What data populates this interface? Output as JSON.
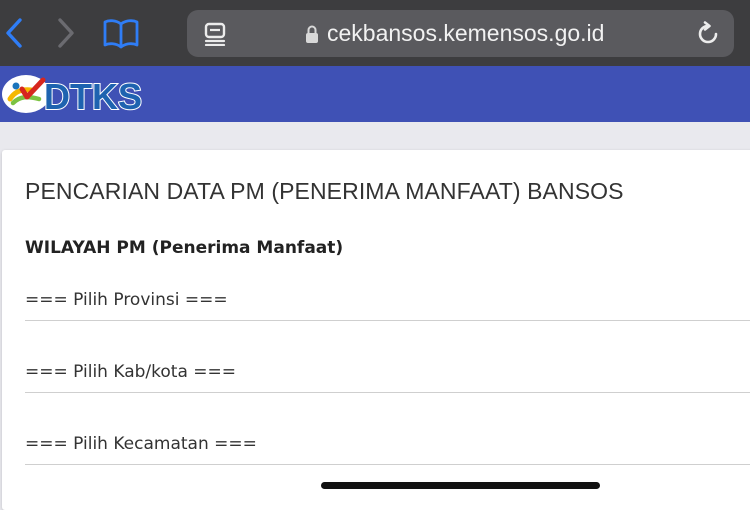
{
  "browser": {
    "url": "cekbansos.kemensos.go.id",
    "icons": {
      "back": "chevron-left-icon",
      "forward": "chevron-right-icon",
      "bookmarks": "book-icon",
      "reader": "reader-icon",
      "lock": "lock-icon",
      "reload": "reload-icon"
    },
    "accent_color": "#2f7df6"
  },
  "site": {
    "logo_text": "DTKS",
    "header_color": "#3f51b5"
  },
  "form": {
    "title": "PENCARIAN DATA PM (PENERIMA MANFAAT) BANSOS",
    "section_label": "WILAYAH PM (Penerima Manfaat)",
    "province_placeholder": "=== Pilih Provinsi ===",
    "city_placeholder": "=== Pilih Kab/kota ===",
    "district_placeholder": "=== Pilih Kecamatan ==="
  }
}
